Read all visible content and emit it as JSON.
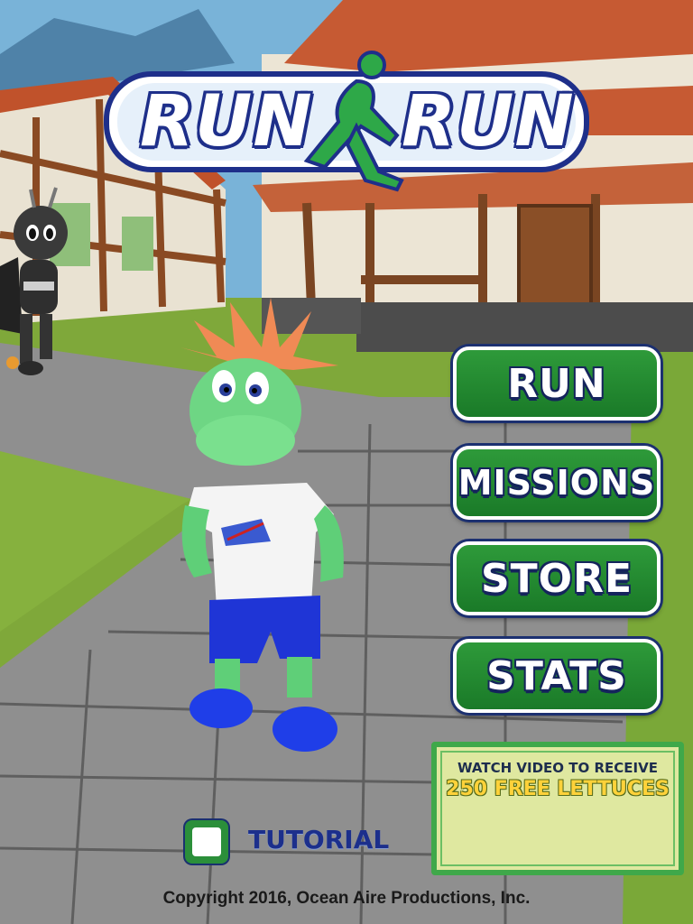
{
  "logo": {
    "left_word": "RUN",
    "right_word": "RUN"
  },
  "menu": {
    "run_label": "RUN",
    "missions_label": "MISSIONS",
    "store_label": "STORE",
    "stats_label": "STATS"
  },
  "video_offer": {
    "line1": "WATCH VIDEO TO RECEIVE",
    "line2": "250 FREE LETTUCES"
  },
  "tutorial": {
    "label": "TUTORIAL",
    "checked": false
  },
  "footer": {
    "copyright": "Copyright 2016, Ocean Aire Productions, Inc."
  },
  "colors": {
    "button_green": "#2e9a3a",
    "logo_blue": "#1e2f8a",
    "banner_yellow": "#ffd23a"
  }
}
